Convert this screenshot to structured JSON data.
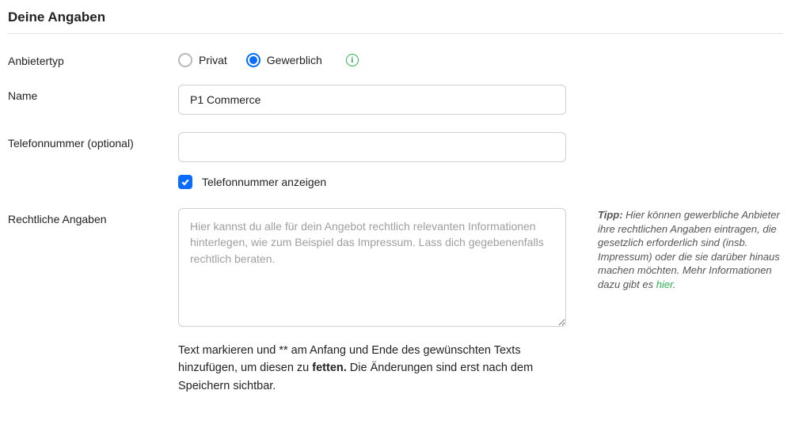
{
  "section": {
    "title": "Deine Angaben"
  },
  "labels": {
    "provider_type": "Anbietertyp",
    "name": "Name",
    "phone": "Telefonnummer (optional)",
    "legal": "Rechtliche Angaben"
  },
  "provider_type": {
    "options": {
      "private": "Privat",
      "commercial": "Gewerblich"
    },
    "selected": "commercial",
    "info_symbol": "i"
  },
  "name": {
    "value": "P1 Commerce",
    "placeholder": ""
  },
  "phone": {
    "value": "",
    "placeholder": "",
    "show_checkbox_checked": true,
    "show_label": "Telefonnummer anzeigen"
  },
  "legal": {
    "value": "",
    "placeholder": "Hier kannst du alle für dein Angebot rechtlich relevanten Informationen hinterlegen, wie zum Beispiel das Impressum. Lass dich gegebenenfalls rechtlich beraten."
  },
  "help": {
    "part1": "Text markieren und ** am Anfang und Ende des gewünschten Texts hinzufügen, um diesen zu ",
    "bold": "fetten.",
    "part2": " Die Änderungen sind erst nach dem Speichern sichtbar."
  },
  "tip": {
    "label": "Tipp:",
    "text": " Hier können gewerbliche Anbieter ihre rechtlichen Angaben eintragen, die gesetzlich erforderlich sind (insb. Impressum) oder die sie darüber hinaus machen möchten. Mehr Informationen dazu gibt es ",
    "link": "hier",
    "after": "."
  }
}
